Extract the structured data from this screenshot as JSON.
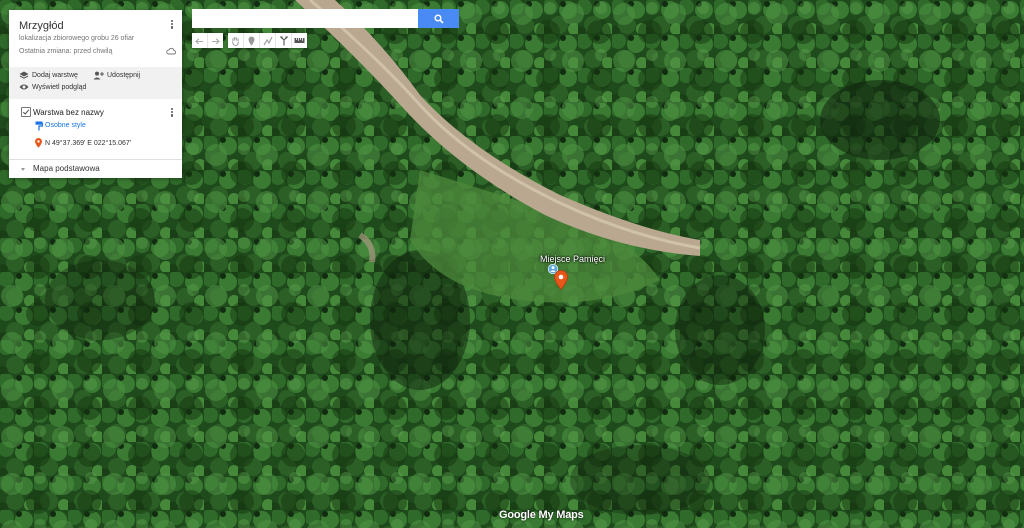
{
  "map": {
    "type": "satellite",
    "marker": {
      "label": "Miejsce Pamięci",
      "color": "#e8571a",
      "icon": "map-pin-icon"
    },
    "attribution": "Google My Maps"
  },
  "search": {
    "value": "",
    "placeholder": "",
    "button_icon": "search-icon",
    "button_color": "#4a8af4"
  },
  "toolbar": {
    "items": [
      "undo-icon",
      "redo-icon",
      "hand-icon",
      "add-marker-icon",
      "draw-line-icon",
      "directions-icon",
      "ruler-icon"
    ]
  },
  "panel": {
    "title": "Mrzygłód",
    "description": "lokalizacja zbiorowego grobu 26 ofiar",
    "last_edit": "Ostatnia zmiana: przed chwilą",
    "actions": {
      "add_layer": "Dodaj warstwę",
      "share": "Udostępnij",
      "preview": "Wyświetl podgląd"
    },
    "layer": {
      "name": "Warstwa bez nazwy",
      "style_link": "Osobne style",
      "place_coords": "N 49°37.369' E 022°15.067'",
      "place_icon_color": "#e8571a"
    },
    "base_map": "Mapa podstawowa"
  }
}
